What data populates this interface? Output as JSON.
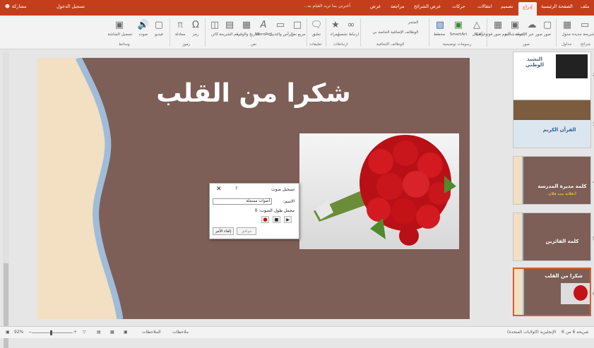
{
  "titlebar": {
    "share": "مشاركة",
    "signin": "تسجيل الدخول",
    "tell_me": "أخبرني بما تريد القيام به...",
    "tabs": [
      "ملف",
      "الصفحة الرئيسية",
      "إدراج",
      "تصميم",
      "انتقالات",
      "حركات",
      "عرض الشرائح",
      "مراجعة",
      "عرض"
    ],
    "active_tab": "إدراج"
  },
  "ribbon": {
    "buttons": {
      "screen_record": "تسجيل الشاشة",
      "audio": "صوت",
      "video": "فيديو",
      "equation": "معادلة",
      "symbol": "رمز",
      "header_footer": "الرأس والتذييل",
      "date_time": "التاريخ والوقت",
      "slide_number": "رقم الشريحة",
      "wordart": "WordArt",
      "textbox": "مربع نص",
      "object": "كائن",
      "comment": "تعليق",
      "link": "ارتباط تشعبي",
      "action": "إجراء",
      "addins": "الوظائف الإضافية الخاصة بي",
      "store": "المتجر",
      "chart": "مخطط",
      "smartart": "SmartArt",
      "shapes": "أشكال",
      "photo_album": "ألبوم صور فوتوغرافية",
      "screenshot": "لقطة شاشة",
      "online_pictures": "صور عبر الإنترنت",
      "pictures": "صور",
      "table": "جدول",
      "new_slide": "شريحة جديدة"
    },
    "groups": {
      "media": "وسائط",
      "symbols": "رموز",
      "text": "نص",
      "comments": "تعليقات",
      "links": "ارتباطات",
      "addins": "الوظائف الإضافية",
      "illustrations": "رسومات توضيحية",
      "images": "صور",
      "tables": "جداول",
      "slides": "شرائح"
    }
  },
  "slide": {
    "title": "شكرا من القلب"
  },
  "dialog": {
    "title": "تسجيل صوت",
    "help": "?",
    "close": "✕",
    "name_label": "الاسم:",
    "name_value": "أصوات مسجلة",
    "length_label": "مجمل طول الصوت:",
    "length_value": "0",
    "ok": "موافق",
    "cancel": "إلغاء الأمر"
  },
  "thumbnails": [
    {
      "num": "2",
      "text": "النشيد الوطني"
    },
    {
      "num": "3",
      "text": "القرآن الكريم"
    },
    {
      "num": "4",
      "text": "كلمة مديرة المدرسة",
      "sub": "أ.فلانة بنت فلان"
    },
    {
      "num": "5",
      "text": "كلمة الفائزين"
    },
    {
      "num": "6",
      "text": "شكرا من القلب"
    }
  ],
  "statusbar": {
    "slide_info": "شريحة 6 من 6",
    "language": "الإنجليزية (الولايات المتحدة)",
    "notes": "الملاحظات",
    "comments": "ملاحظات",
    "zoom": "92%"
  },
  "colors": {
    "accent": "#c43e1c",
    "slide_bg": "#7d5f57",
    "thumb_sel": "#d45f34"
  }
}
